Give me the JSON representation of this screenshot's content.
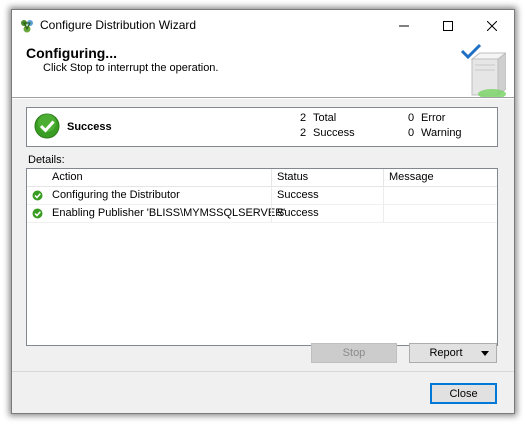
{
  "window": {
    "title": "Configure Distribution Wizard"
  },
  "header": {
    "title": "Configuring...",
    "subtitle": "Click Stop to interrupt the operation."
  },
  "summary": {
    "status": "Success",
    "total_count": "2",
    "total_label": "Total",
    "success_count": "2",
    "success_label": "Success",
    "error_count": "0",
    "error_label": "Error",
    "warning_count": "0",
    "warning_label": "Warning"
  },
  "details": {
    "label": "Details:",
    "columns": {
      "action": "Action",
      "status": "Status",
      "message": "Message"
    },
    "rows": [
      {
        "icon": "success-icon",
        "action": "Configuring the Distributor",
        "status": "Success",
        "message": ""
      },
      {
        "icon": "success-icon",
        "action": "Enabling Publisher 'BLISS\\MYMSSQLSERVER'",
        "status": "Success",
        "message": ""
      }
    ]
  },
  "buttons": {
    "stop": "Stop",
    "report": "Report",
    "close": "Close"
  },
  "colors": {
    "accent": "#0078d7",
    "success": "#3a9d23"
  }
}
